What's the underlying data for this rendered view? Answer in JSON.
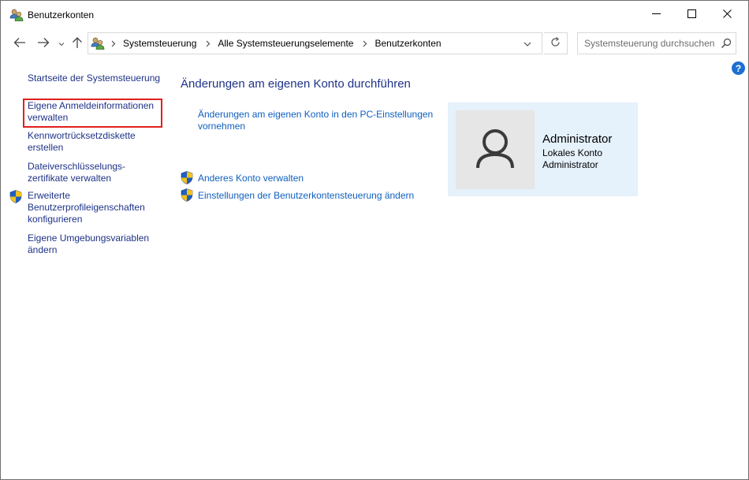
{
  "window": {
    "title": "Benutzerkonten",
    "title_icon": "users-icon",
    "controls": [
      "minimize-icon",
      "maximize-icon",
      "close-icon"
    ]
  },
  "address_bar": {
    "breadcrumbs": [
      "Systemsteuerung",
      "Alle Systemsteuerungselemente",
      "Benutzerkonten"
    ],
    "search_placeholder": "Systemsteuerung durchsuchen"
  },
  "left_nav": {
    "home": "Startseite der Systemsteuerung",
    "items": [
      {
        "label": "Eigene Anmeldeinformationen verwalten",
        "highlighted": true
      },
      {
        "label": "Kennwortrücksetzdiskette erstellen"
      },
      {
        "label": "Dateiverschlüsselungs-zertifikate verwalten"
      },
      {
        "label": "Erweiterte Benutzerprofileigenschaften konfigurieren",
        "icon": "shield-icon"
      },
      {
        "label": "Eigene Umgebungsvariablen ändern"
      }
    ]
  },
  "main": {
    "title": "Änderungen am eigenen Konto durchführen",
    "links": {
      "pc_settings": "Änderungen am eigenen Konto in den PC-Einstellungen vornehmen",
      "other_account": "Anderes Konto verwalten",
      "uac": "Einstellungen der Benutzerkontensteuerung ändern"
    }
  },
  "account": {
    "name": "Administrator",
    "type": "Lokales Konto",
    "role": "Administrator"
  },
  "colors": {
    "nav_link": "#1e3287",
    "link": "#0f5fbf",
    "card_bg": "#e5f1fb",
    "highlight": "#e0201c",
    "help": "#1d6fd1"
  }
}
